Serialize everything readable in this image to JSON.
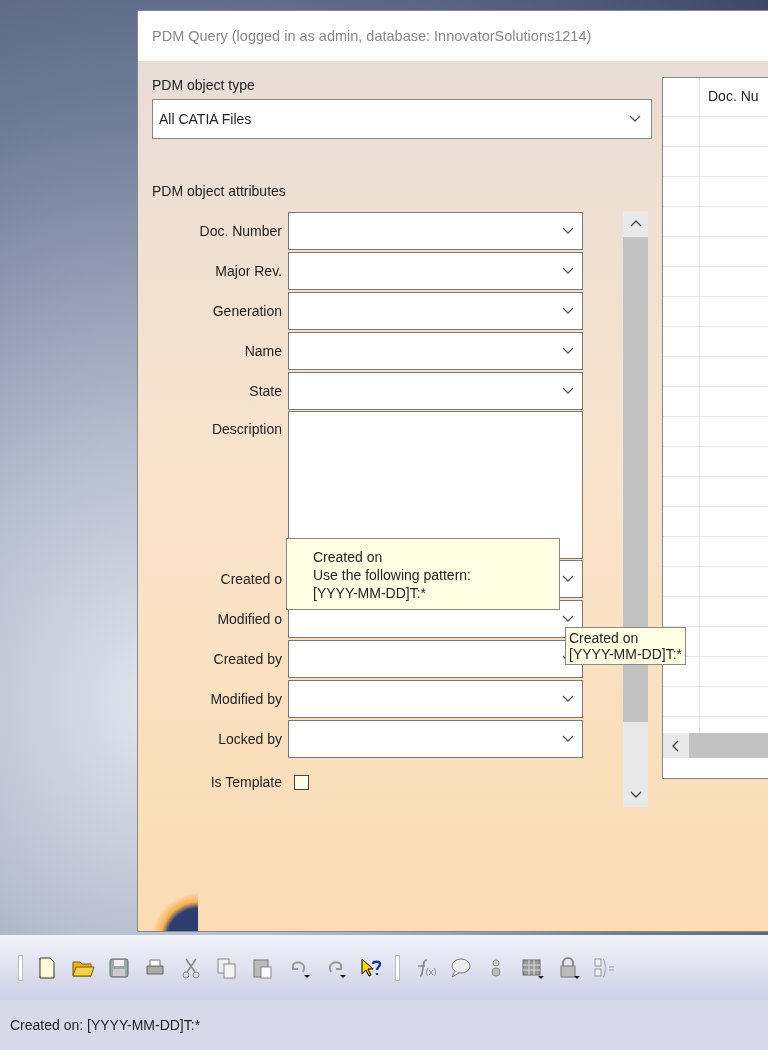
{
  "window": {
    "title": "PDM Query (logged in as admin, database: InnovatorSolutions1214)"
  },
  "object_type": {
    "label": "PDM object type",
    "value": "All CATIA Files"
  },
  "attributes": {
    "label": "PDM object attributes",
    "fields": [
      {
        "label": "Doc. Number",
        "kind": "combo"
      },
      {
        "label": "Major Rev.",
        "kind": "combo"
      },
      {
        "label": "Generation",
        "kind": "combo"
      },
      {
        "label": "Name",
        "kind": "combo"
      },
      {
        "label": "State",
        "kind": "combo"
      },
      {
        "label": "Description",
        "kind": "textarea"
      },
      {
        "label": "Created o",
        "kind": "combo"
      },
      {
        "label": "Modified o",
        "kind": "combo"
      },
      {
        "label": "Created by",
        "kind": "combo"
      },
      {
        "label": "Modified by",
        "kind": "combo"
      },
      {
        "label": "Locked by",
        "kind": "combo"
      },
      {
        "label": "Is Template",
        "kind": "checkbox",
        "checked": false
      }
    ]
  },
  "results_table": {
    "columns": [
      "Doc. Nu"
    ]
  },
  "tooltips": [
    {
      "lines": [
        "Created on",
        "Use the following pattern:",
        "[YYYY-MM-DD]T:*"
      ]
    },
    {
      "lines": [
        "Created on",
        "[YYYY-MM-DD]T:*"
      ]
    }
  ],
  "status_bar": "Created on: [YYYY-MM-DD]T:*"
}
